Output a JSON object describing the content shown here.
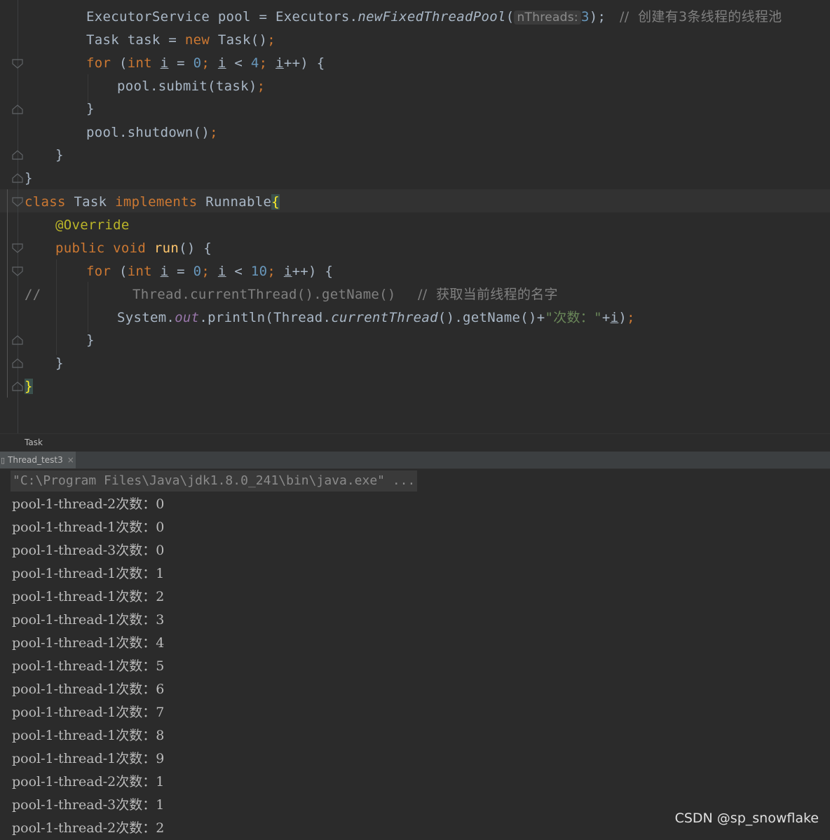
{
  "editor": {
    "lines": {
      "l1": {
        "a": "ExecutorService pool = Executors.",
        "b": "newFixedThreadPool",
        "c": "(",
        "hint": "nThreads:",
        "d": "3",
        "e": ");",
        "comment": "//  创建有3条线程的线程池"
      },
      "l2": {
        "a": "Task task = ",
        "kw": "new",
        "b": " Task()",
        "semi": ";"
      },
      "l3": {
        "kw": "for",
        "a": " (",
        "kw2": "int",
        "sp": " ",
        "i1": "i",
        "b": " = ",
        "n0": "0",
        "s1": "; ",
        "i2": "i",
        "c": " < ",
        "n4": "4",
        "s2": "; ",
        "i3": "i",
        "d": "++) {"
      },
      "l4": {
        "a": "pool.submit(task)",
        "semi": ";"
      },
      "l5": {
        "a": "}"
      },
      "l6": {
        "a": "pool.shutdown()",
        "semi": ";"
      },
      "l7": {
        "a": "}"
      },
      "l8": {
        "a": "}"
      },
      "l9": {
        "kw": "class",
        "a": " Task ",
        "kw2": "implements",
        "b": " Runnable",
        "brace": "{"
      },
      "l10": {
        "ann": "@Override"
      },
      "l11": {
        "kw": "public",
        "kw2": " void",
        "fn": " run",
        "a": "() {"
      },
      "l12": {
        "kw": "for",
        "a": " (",
        "kw2": "int",
        "sp": " ",
        "i1": "i",
        "b": " = ",
        "n0": "0",
        "s1": "; ",
        "i2": "i",
        "c": " < ",
        "n10": "10",
        "s2": "; ",
        "i3": "i",
        "d": "++) {"
      },
      "l13": {
        "slash": "//",
        "a": "Thread.currentThread().getName()",
        "comment": "//  获取当前线程的名字"
      },
      "l14": {
        "a": "System.",
        "field": "out",
        "b": ".println(Thread.",
        "ital": "currentThread",
        "c": "().getName()+",
        "str": "\"次数：\"",
        "d": "+",
        "i": "i",
        "e": ")",
        "semi": ";"
      },
      "l15": {
        "a": "}"
      },
      "l16": {
        "a": "}"
      },
      "l17": {
        "brace": "}"
      }
    }
  },
  "breadcrumb": {
    "label": "Task"
  },
  "run_tab": {
    "label": "Thread_test3",
    "close": "×",
    "icon": "▯"
  },
  "console": {
    "command": "\"C:\\Program Files\\Java\\jdk1.8.0_241\\bin\\java.exe\" ...",
    "output": [
      "pool-1-thread-2次数：0",
      "pool-1-thread-1次数：0",
      "pool-1-thread-3次数：0",
      "pool-1-thread-1次数：1",
      "pool-1-thread-1次数：2",
      "pool-1-thread-1次数：3",
      "pool-1-thread-1次数：4",
      "pool-1-thread-1次数：5",
      "pool-1-thread-1次数：6",
      "pool-1-thread-1次数：7",
      "pool-1-thread-1次数：8",
      "pool-1-thread-1次数：9",
      "pool-1-thread-2次数：1",
      "pool-1-thread-3次数：1",
      "pool-1-thread-2次数：2"
    ]
  },
  "watermark": "CSDN @sp_snowflake"
}
